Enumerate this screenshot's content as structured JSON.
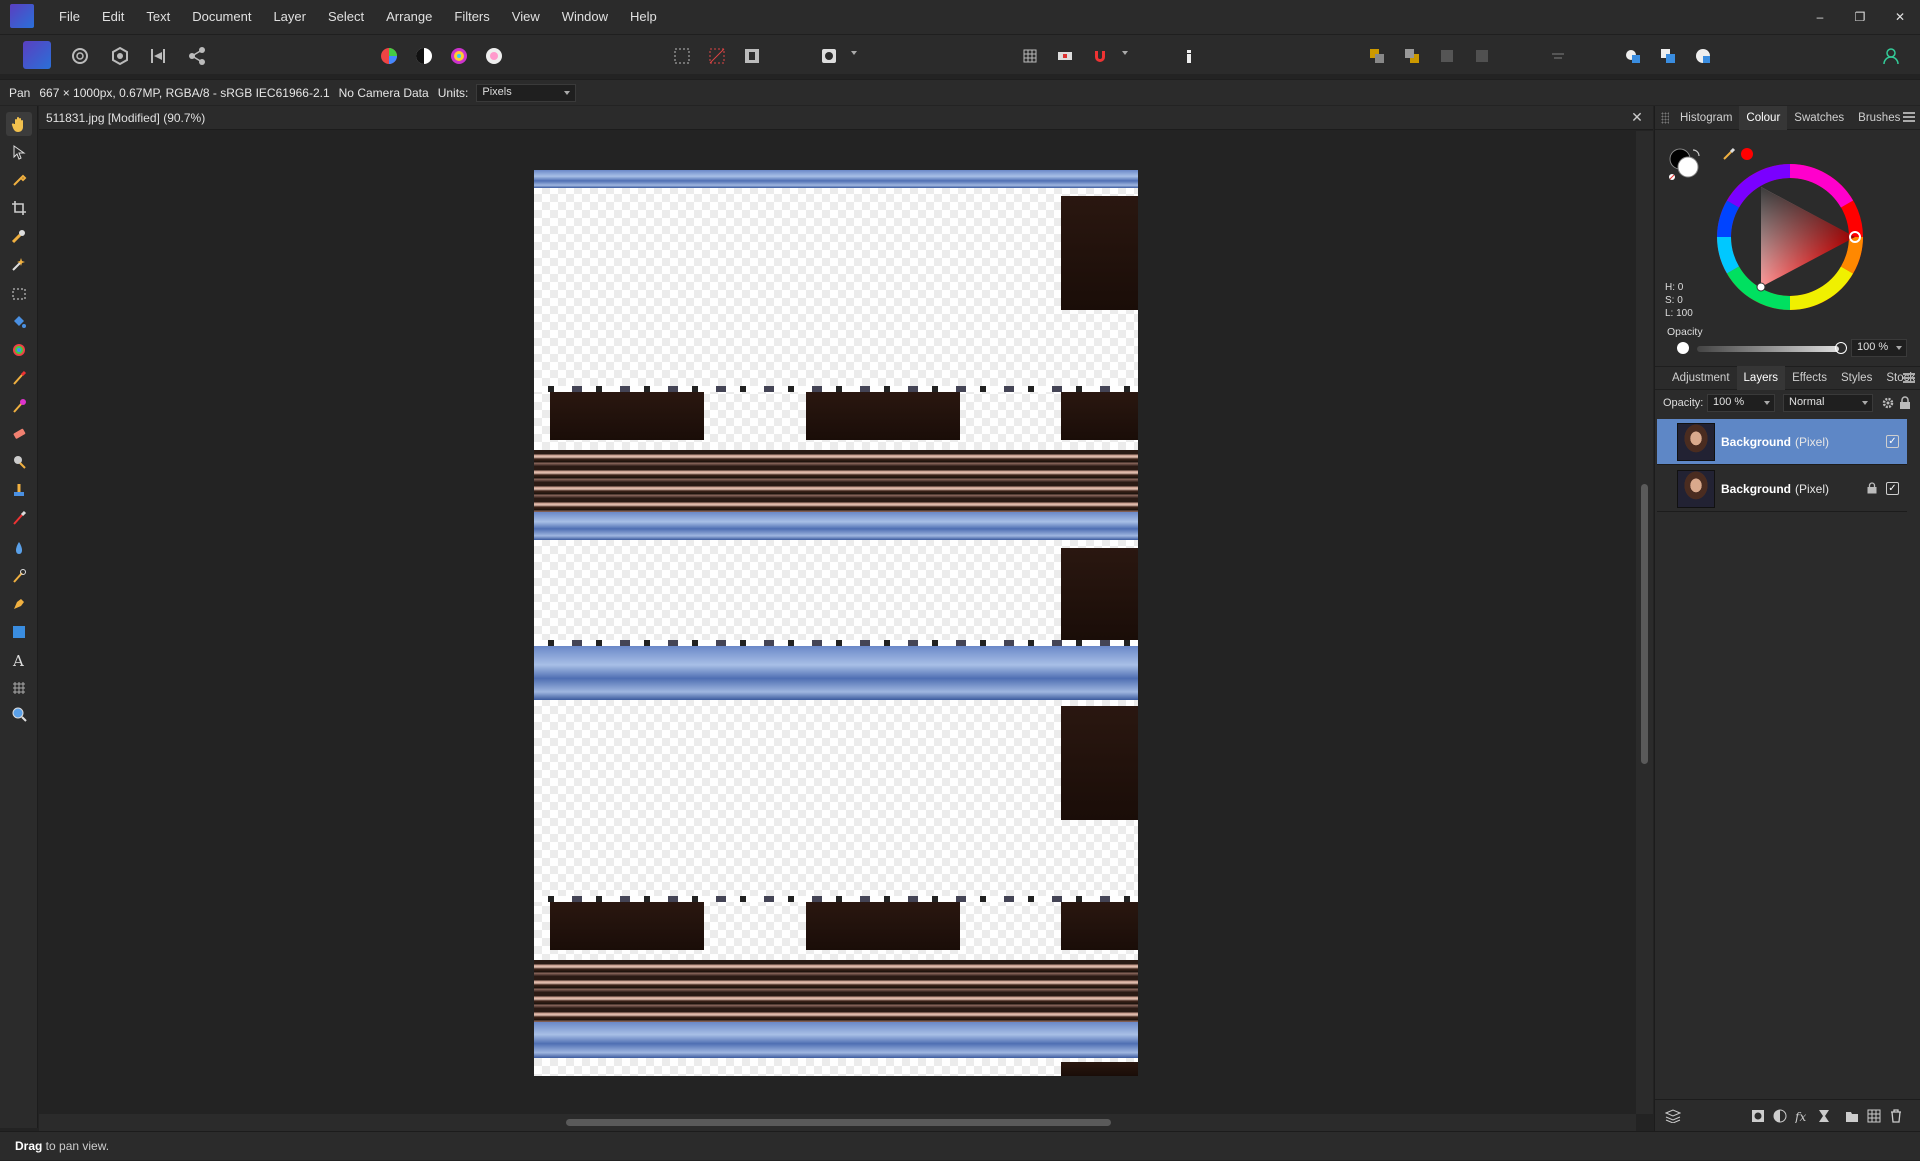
{
  "menu": [
    "File",
    "Edit",
    "Text",
    "Document",
    "Layer",
    "Select",
    "Arrange",
    "Filters",
    "View",
    "Window",
    "Help"
  ],
  "context": {
    "tool": "Pan",
    "doc_info": "667 × 1000px, 0.67MP, RGBA/8 - sRGB IEC61966-2.1",
    "camera": "No Camera Data",
    "units_label": "Units:",
    "units_value": "Pixels"
  },
  "document": {
    "tab_title": "511831.jpg [Modified] (90.7%)",
    "close": "✕"
  },
  "colour_panel": {
    "tabs": [
      "Histogram",
      "Colour",
      "Swatches",
      "Brushes"
    ],
    "active_tab": "Colour",
    "h": "H: 0",
    "s": "S: 0",
    "l": "L: 100",
    "opacity_label": "Opacity",
    "opacity_value": "100 %",
    "accent_color": "#ff0000"
  },
  "layers_panel": {
    "tabs": [
      "Adjustment",
      "Layers",
      "Effects",
      "Styles",
      "Stock"
    ],
    "active_tab": "Layers",
    "opacity_label": "Opacity:",
    "opacity_value": "100 %",
    "blend_mode": "Normal",
    "layers": [
      {
        "name": "Background",
        "type": "(Pixel)",
        "selected": true,
        "locked": false,
        "visible": true
      },
      {
        "name": "Background",
        "type": "(Pixel)",
        "selected": false,
        "locked": true,
        "visible": true
      }
    ]
  },
  "status": {
    "bold": "Drag",
    "text": " to pan view."
  },
  "win_controls": [
    "–",
    "❐",
    "✕"
  ],
  "selection_color": "#5e87c6"
}
